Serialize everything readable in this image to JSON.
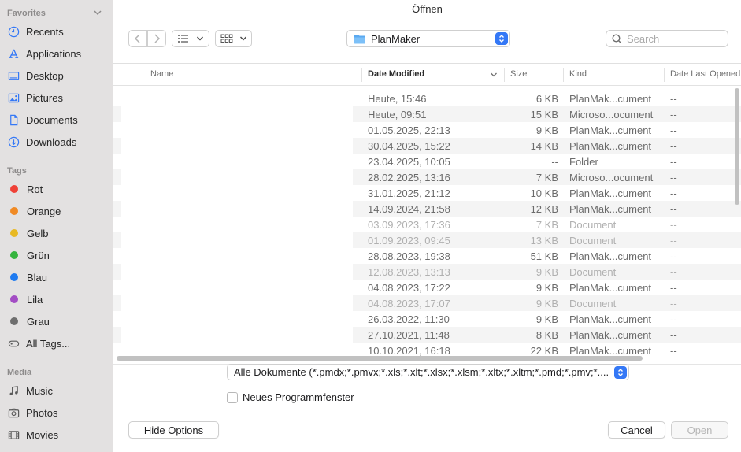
{
  "window": {
    "title": "Öffnen"
  },
  "sidebar": {
    "favorites_label": "Favorites",
    "favorites": [
      {
        "label": "Recents",
        "icon": "clock-icon"
      },
      {
        "label": "Applications",
        "icon": "applications-icon"
      },
      {
        "label": "Desktop",
        "icon": "desktop-icon"
      },
      {
        "label": "Pictures",
        "icon": "pictures-icon"
      },
      {
        "label": "Documents",
        "icon": "document-icon"
      },
      {
        "label": "Downloads",
        "icon": "download-icon"
      }
    ],
    "tags_label": "Tags",
    "tags": [
      {
        "label": "Rot",
        "color": "#ef4137"
      },
      {
        "label": "Orange",
        "color": "#f08a24"
      },
      {
        "label": "Gelb",
        "color": "#e8b923"
      },
      {
        "label": "Grün",
        "color": "#35b43e"
      },
      {
        "label": "Blau",
        "color": "#1f7bf0"
      },
      {
        "label": "Lila",
        "color": "#a34dc4"
      },
      {
        "label": "Grau",
        "color": "#6e6e6e"
      },
      {
        "label": "All Tags...",
        "color": ""
      }
    ],
    "media_label": "Media",
    "media": [
      {
        "label": "Music",
        "icon": "music-icon"
      },
      {
        "label": "Photos",
        "icon": "camera-icon"
      },
      {
        "label": "Movies",
        "icon": "film-icon"
      }
    ]
  },
  "toolbar": {
    "folder_name": "PlanMaker",
    "search_placeholder": "Search",
    "accent": "#3478f6"
  },
  "table": {
    "columns": {
      "name": "Name",
      "date_modified": "Date Modified",
      "size": "Size",
      "kind": "Kind",
      "date_last_opened": "Date Last Opened"
    },
    "rows": [
      {
        "date": "Heute, 15:46",
        "size": "6 KB",
        "kind": "PlanMak...cument",
        "last": "--",
        "dim": false
      },
      {
        "date": "Heute, 09:51",
        "size": "15 KB",
        "kind": "Microso...ocument",
        "last": "--",
        "dim": false
      },
      {
        "date": "01.05.2025, 22:13",
        "size": "9 KB",
        "kind": "PlanMak...cument",
        "last": "--",
        "dim": false
      },
      {
        "date": "30.04.2025, 15:22",
        "size": "14 KB",
        "kind": "PlanMak...cument",
        "last": "--",
        "dim": false
      },
      {
        "date": "23.04.2025, 10:05",
        "size": "--",
        "kind": "Folder",
        "last": "--",
        "dim": false
      },
      {
        "date": "28.02.2025, 13:16",
        "size": "7 KB",
        "kind": "Microso...ocument",
        "last": "--",
        "dim": false
      },
      {
        "date": "31.01.2025, 21:12",
        "size": "10 KB",
        "kind": "PlanMak...cument",
        "last": "--",
        "dim": false
      },
      {
        "date": "14.09.2024, 21:58",
        "size": "12 KB",
        "kind": "PlanMak...cument",
        "last": "--",
        "dim": false
      },
      {
        "date": "03.09.2023, 17:36",
        "size": "7 KB",
        "kind": "Document",
        "last": "--",
        "dim": true
      },
      {
        "date": "01.09.2023, 09:45",
        "size": "13 KB",
        "kind": "Document",
        "last": "--",
        "dim": true
      },
      {
        "date": "28.08.2023, 19:38",
        "size": "51 KB",
        "kind": "PlanMak...cument",
        "last": "--",
        "dim": false
      },
      {
        "date": "12.08.2023, 13:13",
        "size": "9 KB",
        "kind": "Document",
        "last": "--",
        "dim": true
      },
      {
        "date": "04.08.2023, 17:22",
        "size": "9 KB",
        "kind": "PlanMak...cument",
        "last": "--",
        "dim": false
      },
      {
        "date": "04.08.2023, 17:07",
        "size": "9 KB",
        "kind": "Document",
        "last": "--",
        "dim": true
      },
      {
        "date": "26.03.2022, 11:30",
        "size": "9 KB",
        "kind": "PlanMak...cument",
        "last": "--",
        "dim": false
      },
      {
        "date": "27.10.2021, 11:48",
        "size": "8 KB",
        "kind": "PlanMak...cument",
        "last": "--",
        "dim": false
      },
      {
        "date": "10.10.2021, 16:18",
        "size": "22 KB",
        "kind": "PlanMak...cument",
        "last": "--",
        "dim": false
      }
    ]
  },
  "options": {
    "filter_value": "Alle Dokumente (*.pmdx;*.pmvx;*.xls;*.xlt;*.xlsx;*.xlsm;*.xltx;*.xltm;*.pmd;*.pmv;*....",
    "new_window_label": "Neues Programmfenster"
  },
  "buttons": {
    "hide_options": "Hide Options",
    "cancel": "Cancel",
    "open": "Open"
  }
}
